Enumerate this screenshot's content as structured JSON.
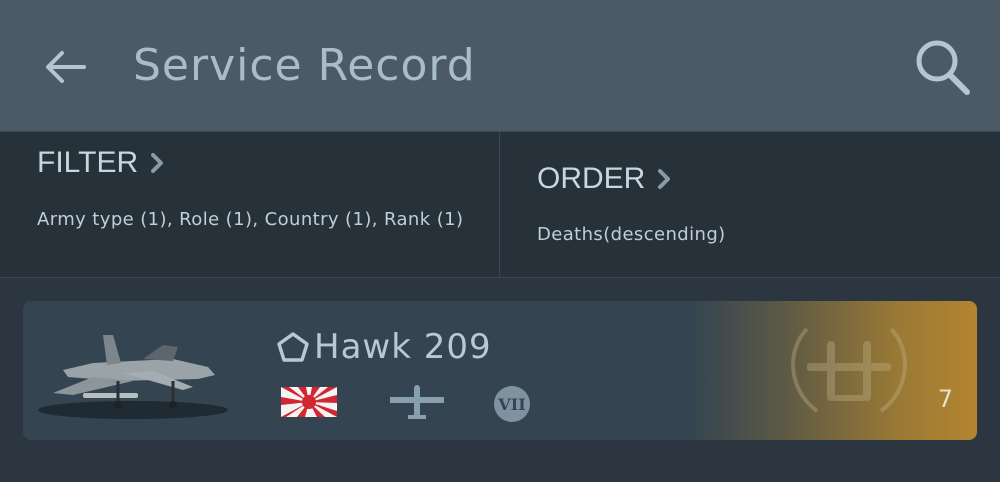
{
  "header": {
    "back_icon": "arrow-left-icon",
    "title": "Service Record",
    "search_icon": "search-icon"
  },
  "filter": {
    "heading": "FILTER",
    "description": "Army type (1), Role (1), Country (1), Rank (1)"
  },
  "order": {
    "heading": "ORDER",
    "description": "Deaths(descending)"
  },
  "records": [
    {
      "name": "Hawk 209",
      "rank_icon": "pentagon-icon",
      "image": "jet-aircraft-image",
      "flag": "rising-sun-flag-icon",
      "role_icon": "aircraft-silhouette-icon",
      "rank_badge": "VII",
      "emblem": "laurel-wreath-aircraft-icon",
      "count": "7"
    }
  ],
  "colors": {
    "header_bg": "#4c5a66",
    "page_bg": "#2b3640",
    "panel_bg": "#26313a",
    "card_bg": "#344450",
    "card_accent": "#b38530"
  }
}
